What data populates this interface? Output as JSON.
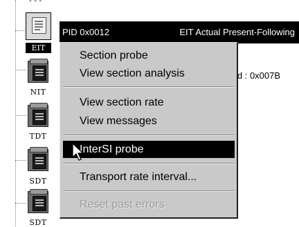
{
  "tree": {
    "top_fragment": "- - -",
    "nodes": [
      {
        "label": "EIT",
        "selected": true,
        "icon": "document-icon"
      },
      {
        "label": "NIT",
        "icon": "document-icon"
      },
      {
        "label": "TDT",
        "icon": "document-icon"
      },
      {
        "label": "SDT",
        "icon": "document-icon"
      },
      {
        "label": "SDT",
        "icon": "document-icon"
      }
    ]
  },
  "detail": {
    "pid": "PID 0x0012",
    "type": "EIT Actual Present-Following",
    "id_fragment": "ld : 0x007B"
  },
  "context_menu": {
    "items": [
      {
        "label": "Section probe",
        "state": "normal"
      },
      {
        "label": "View section analysis",
        "state": "normal"
      },
      {
        "label": "View section rate",
        "state": "normal"
      },
      {
        "label": "View messages",
        "state": "normal"
      },
      {
        "label": "InterSI probe",
        "state": "highlighted"
      },
      {
        "label": "Transport rate interval...",
        "state": "normal"
      },
      {
        "label": "Reset past errors",
        "state": "disabled"
      }
    ]
  },
  "colors": {
    "menu_background": "#c9c9c9",
    "highlight": "#000000",
    "disabled_text": "#9c9c9c"
  }
}
